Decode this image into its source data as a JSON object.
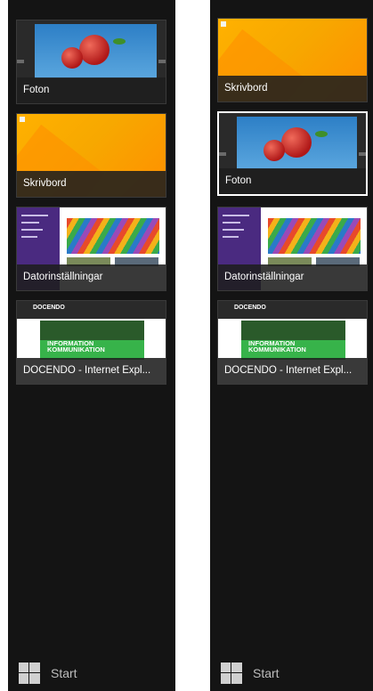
{
  "panels": [
    {
      "apps": [
        {
          "label": "Foton",
          "type": "photo",
          "selected": false
        },
        {
          "label": "Skrivbord",
          "type": "desktop",
          "selected": false
        },
        {
          "label": "Datorinställningar",
          "type": "settings",
          "selected": false
        },
        {
          "label": "DOCENDO - Internet Expl...",
          "type": "browser",
          "selected": false
        }
      ],
      "start_label": "Start"
    },
    {
      "apps": [
        {
          "label": "Skrivbord",
          "type": "desktop",
          "selected": false
        },
        {
          "label": "Foton",
          "type": "photo",
          "selected": true
        },
        {
          "label": "Datorinställningar",
          "type": "settings",
          "selected": false
        },
        {
          "label": "DOCENDO - Internet Expl...",
          "type": "browser",
          "selected": false
        }
      ],
      "start_label": "Start"
    }
  ],
  "browser_preview": {
    "logo": "DOCENDO",
    "banner_line1": "INFORMATION",
    "banner_line2": "KOMMUNIKATION"
  },
  "colors": {
    "switcher_bg": "#141414",
    "caption_bg": "#1e1e1e",
    "selection": "#ffffff",
    "desktop_accent": "#ffb100"
  },
  "icons": {
    "start": "windows-logo-icon"
  }
}
